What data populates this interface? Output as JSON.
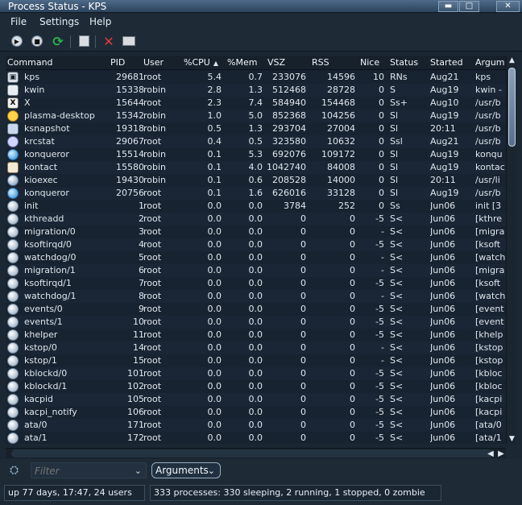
{
  "window": {
    "title": "Process Status - KPS",
    "buttons": [
      "▬",
      "□",
      "✕"
    ]
  },
  "menu": [
    {
      "label": "File"
    },
    {
      "label": "Settings"
    },
    {
      "label": "Help"
    }
  ],
  "toolbar": [
    {
      "name": "play-button",
      "icon": "play-icon"
    },
    {
      "name": "stop-button",
      "icon": "stop-icon"
    },
    {
      "name": "refresh-button",
      "icon": "refresh-icon"
    },
    {
      "name": "details-button",
      "icon": "document-icon"
    },
    {
      "name": "kill-button",
      "icon": "close-icon"
    },
    {
      "name": "tree-button",
      "icon": "film-icon"
    }
  ],
  "columns": [
    {
      "label": "Command"
    },
    {
      "label": "PID"
    },
    {
      "label": "User"
    },
    {
      "label": "%CPU"
    },
    {
      "label": "%Mem"
    },
    {
      "label": "VSZ"
    },
    {
      "label": "RSS"
    },
    {
      "label": "Nice"
    },
    {
      "label": "Status"
    },
    {
      "label": "Started"
    },
    {
      "label": "Argum"
    }
  ],
  "processes": [
    {
      "icon": "kps",
      "command": "kps",
      "pid": "29681",
      "user": "root",
      "cpu": "5.4",
      "mem": "0.7",
      "vsz": "233076",
      "rss": "14596",
      "nice": "10",
      "status": "RNs",
      "started": "Aug21",
      "args": "kps"
    },
    {
      "icon": "kwin",
      "command": "kwin",
      "pid": "15338",
      "user": "robin",
      "cpu": "2.8",
      "mem": "1.3",
      "vsz": "512468",
      "rss": "28728",
      "nice": "0",
      "status": "S",
      "started": "Aug19",
      "args": "kwin -"
    },
    {
      "icon": "x",
      "command": "X",
      "pid": "15644",
      "user": "root",
      "cpu": "2.3",
      "mem": "7.4",
      "vsz": "584940",
      "rss": "154468",
      "nice": "0",
      "status": "Ss+",
      "started": "Aug10",
      "args": "/usr/b"
    },
    {
      "icon": "plasma",
      "command": "plasma-desktop",
      "pid": "15342",
      "user": "robin",
      "cpu": "1.0",
      "mem": "5.0",
      "vsz": "852368",
      "rss": "104256",
      "nice": "0",
      "status": "Sl",
      "started": "Aug19",
      "args": "/usr/b"
    },
    {
      "icon": "snapshot",
      "command": "ksnapshot",
      "pid": "19318",
      "user": "robin",
      "cpu": "0.5",
      "mem": "1.3",
      "vsz": "293704",
      "rss": "27004",
      "nice": "0",
      "status": "Sl",
      "started": "20:11",
      "args": "/usr/b"
    },
    {
      "icon": "krcstat",
      "command": "krcstat",
      "pid": "29067",
      "user": "root",
      "cpu": "0.4",
      "mem": "0.5",
      "vsz": "323580",
      "rss": "10632",
      "nice": "0",
      "status": "Ssl",
      "started": "Aug21",
      "args": "/usr/b"
    },
    {
      "icon": "konqueror",
      "command": "konqueror",
      "pid": "15514",
      "user": "robin",
      "cpu": "0.1",
      "mem": "5.3",
      "vsz": "692076",
      "rss": "109172",
      "nice": "0",
      "status": "Sl",
      "started": "Aug19",
      "args": "konqu"
    },
    {
      "icon": "kontact",
      "command": "kontact",
      "pid": "15580",
      "user": "robin",
      "cpu": "0.1",
      "mem": "4.0",
      "vsz": "1042740",
      "rss": "84008",
      "nice": "0",
      "status": "Sl",
      "started": "Aug19",
      "args": "kontac"
    },
    {
      "icon": "kioexec",
      "command": "kioexec",
      "pid": "19430",
      "user": "robin",
      "cpu": "0.1",
      "mem": "0.6",
      "vsz": "208528",
      "rss": "14000",
      "nice": "0",
      "status": "Sl",
      "started": "20:11",
      "args": "/usr/li"
    },
    {
      "icon": "konqueror",
      "command": "konqueror",
      "pid": "20756",
      "user": "root",
      "cpu": "0.1",
      "mem": "1.6",
      "vsz": "626016",
      "rss": "33128",
      "nice": "0",
      "status": "Sl",
      "started": "Aug19",
      "args": "/usr/b"
    },
    {
      "icon": "generic",
      "command": "init",
      "pid": "1",
      "user": "root",
      "cpu": "0.0",
      "mem": "0.0",
      "vsz": "3784",
      "rss": "252",
      "nice": "0",
      "status": "Ss",
      "started": "Jun06",
      "args": "init [3"
    },
    {
      "icon": "generic",
      "command": "kthreadd",
      "pid": "2",
      "user": "root",
      "cpu": "0.0",
      "mem": "0.0",
      "vsz": "0",
      "rss": "0",
      "nice": "-5",
      "status": "S<",
      "started": "Jun06",
      "args": "[kthre"
    },
    {
      "icon": "generic",
      "command": "migration/0",
      "pid": "3",
      "user": "root",
      "cpu": "0.0",
      "mem": "0.0",
      "vsz": "0",
      "rss": "0",
      "nice": "-",
      "status": "S<",
      "started": "Jun06",
      "args": "[migra"
    },
    {
      "icon": "generic",
      "command": "ksoftirqd/0",
      "pid": "4",
      "user": "root",
      "cpu": "0.0",
      "mem": "0.0",
      "vsz": "0",
      "rss": "0",
      "nice": "-5",
      "status": "S<",
      "started": "Jun06",
      "args": "[ksoft"
    },
    {
      "icon": "generic",
      "command": "watchdog/0",
      "pid": "5",
      "user": "root",
      "cpu": "0.0",
      "mem": "0.0",
      "vsz": "0",
      "rss": "0",
      "nice": "-",
      "status": "S<",
      "started": "Jun06",
      "args": "[watch"
    },
    {
      "icon": "generic",
      "command": "migration/1",
      "pid": "6",
      "user": "root",
      "cpu": "0.0",
      "mem": "0.0",
      "vsz": "0",
      "rss": "0",
      "nice": "-",
      "status": "S<",
      "started": "Jun06",
      "args": "[migra"
    },
    {
      "icon": "generic",
      "command": "ksoftirqd/1",
      "pid": "7",
      "user": "root",
      "cpu": "0.0",
      "mem": "0.0",
      "vsz": "0",
      "rss": "0",
      "nice": "-5",
      "status": "S<",
      "started": "Jun06",
      "args": "[ksoft"
    },
    {
      "icon": "generic",
      "command": "watchdog/1",
      "pid": "8",
      "user": "root",
      "cpu": "0.0",
      "mem": "0.0",
      "vsz": "0",
      "rss": "0",
      "nice": "-",
      "status": "S<",
      "started": "Jun06",
      "args": "[watch"
    },
    {
      "icon": "generic",
      "command": "events/0",
      "pid": "9",
      "user": "root",
      "cpu": "0.0",
      "mem": "0.0",
      "vsz": "0",
      "rss": "0",
      "nice": "-5",
      "status": "S<",
      "started": "Jun06",
      "args": "[event"
    },
    {
      "icon": "generic",
      "command": "events/1",
      "pid": "10",
      "user": "root",
      "cpu": "0.0",
      "mem": "0.0",
      "vsz": "0",
      "rss": "0",
      "nice": "-5",
      "status": "S<",
      "started": "Jun06",
      "args": "[event"
    },
    {
      "icon": "generic",
      "command": "khelper",
      "pid": "11",
      "user": "root",
      "cpu": "0.0",
      "mem": "0.0",
      "vsz": "0",
      "rss": "0",
      "nice": "-5",
      "status": "S<",
      "started": "Jun06",
      "args": "[khelp"
    },
    {
      "icon": "generic",
      "command": "kstop/0",
      "pid": "14",
      "user": "root",
      "cpu": "0.0",
      "mem": "0.0",
      "vsz": "0",
      "rss": "0",
      "nice": "-",
      "status": "S<",
      "started": "Jun06",
      "args": "[kstop"
    },
    {
      "icon": "generic",
      "command": "kstop/1",
      "pid": "15",
      "user": "root",
      "cpu": "0.0",
      "mem": "0.0",
      "vsz": "0",
      "rss": "0",
      "nice": "-",
      "status": "S<",
      "started": "Jun06",
      "args": "[kstop"
    },
    {
      "icon": "generic",
      "command": "kblockd/0",
      "pid": "101",
      "user": "root",
      "cpu": "0.0",
      "mem": "0.0",
      "vsz": "0",
      "rss": "0",
      "nice": "-5",
      "status": "S<",
      "started": "Jun06",
      "args": "[kbloc"
    },
    {
      "icon": "generic",
      "command": "kblockd/1",
      "pid": "102",
      "user": "root",
      "cpu": "0.0",
      "mem": "0.0",
      "vsz": "0",
      "rss": "0",
      "nice": "-5",
      "status": "S<",
      "started": "Jun06",
      "args": "[kbloc"
    },
    {
      "icon": "generic",
      "command": "kacpid",
      "pid": "105",
      "user": "root",
      "cpu": "0.0",
      "mem": "0.0",
      "vsz": "0",
      "rss": "0",
      "nice": "-5",
      "status": "S<",
      "started": "Jun06",
      "args": "[kacpi"
    },
    {
      "icon": "generic",
      "command": "kacpi_notify",
      "pid": "106",
      "user": "root",
      "cpu": "0.0",
      "mem": "0.0",
      "vsz": "0",
      "rss": "0",
      "nice": "-5",
      "status": "S<",
      "started": "Jun06",
      "args": "[kacpi"
    },
    {
      "icon": "generic",
      "command": "ata/0",
      "pid": "171",
      "user": "root",
      "cpu": "0.0",
      "mem": "0.0",
      "vsz": "0",
      "rss": "0",
      "nice": "-5",
      "status": "S<",
      "started": "Jun06",
      "args": "[ata/0"
    },
    {
      "icon": "generic",
      "command": "ata/1",
      "pid": "172",
      "user": "root",
      "cpu": "0.0",
      "mem": "0.0",
      "vsz": "0",
      "rss": "0",
      "nice": "-5",
      "status": "S<",
      "started": "Jun06",
      "args": "[ata/1"
    }
  ],
  "filter": {
    "placeholder": "Filter",
    "field": "Arguments"
  },
  "statusbar": {
    "uptime": "up 77 days, 17:47, 24 users",
    "processes": "333 processes: 330 sleeping, 2 running, 1 stopped, 0 zombie"
  }
}
